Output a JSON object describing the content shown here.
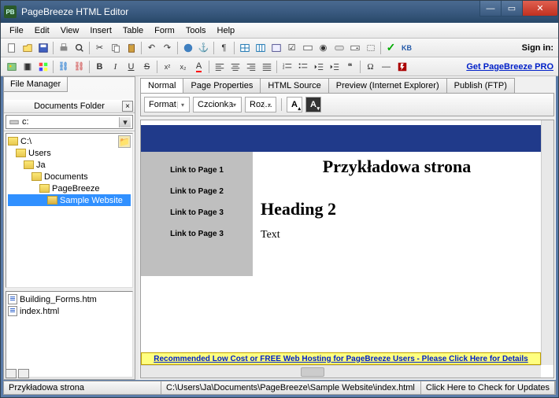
{
  "window": {
    "title": "PageBreeze HTML Editor"
  },
  "menu": [
    "File",
    "Edit",
    "View",
    "Insert",
    "Table",
    "Form",
    "Tools",
    "Help"
  ],
  "toolbar": {
    "signin_label": "Sign in:",
    "promo_link": "Get PageBreeze PRO",
    "kb_label": "KB"
  },
  "left": {
    "tab_label": "File Manager",
    "folder_header": "Documents Folder",
    "drive": "c:",
    "tree": [
      {
        "label": "C:\\",
        "depth": 0
      },
      {
        "label": "Users",
        "depth": 1
      },
      {
        "label": "Ja",
        "depth": 2
      },
      {
        "label": "Documents",
        "depth": 3
      },
      {
        "label": "PageBreeze",
        "depth": 4
      },
      {
        "label": "Sample Website",
        "depth": 5,
        "selected": true
      }
    ],
    "files": [
      "Building_Forms.htm",
      "index.html"
    ]
  },
  "tabs": [
    "Normal",
    "Page Properties",
    "HTML Source",
    "Preview (Internet Explorer)",
    "Publish (FTP)"
  ],
  "format_bar": {
    "format": "Format",
    "font": "Czcionka",
    "size": "Roz...",
    "a_plus": "A",
    "a_color": "A"
  },
  "page": {
    "title_text": "Przykładowa strona",
    "side_links": [
      "Link to Page 1",
      "Link to Page 2",
      "Link to Page 3",
      "Link to Page 3"
    ],
    "h2": "Heading 2",
    "body_text": "Text"
  },
  "promo_banner": "Recommended Low Cost or FREE Web Hosting for PageBreeze Users  -  Please Click Here for Details",
  "status": {
    "left": "Przykładowa strona",
    "path": "C:\\Users\\Ja\\Documents\\PageBreeze\\Sample Website\\index.html",
    "right": "Click Here to Check for Updates"
  }
}
